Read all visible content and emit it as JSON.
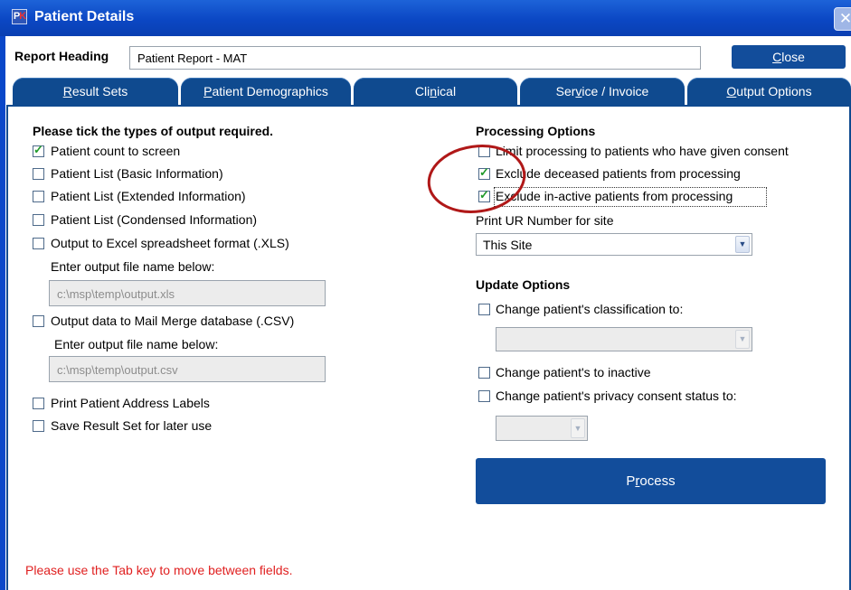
{
  "window": {
    "title": "Patient Details",
    "app_icon": "pk-app-icon",
    "close_glyph": "✕"
  },
  "header": {
    "report_heading_label": "Report Heading",
    "report_heading_value": "Patient Report - MAT",
    "close_button_rest": "lose",
    "close_button_mnemonic": "C"
  },
  "tabs": [
    {
      "pre": "",
      "mnemonic": "R",
      "post": "esult Sets",
      "active": false
    },
    {
      "pre": "",
      "mnemonic": "P",
      "post": "atient Demographics",
      "active": false
    },
    {
      "pre": "Cli",
      "mnemonic": "n",
      "post": "ical",
      "active": false
    },
    {
      "pre": "Ser",
      "mnemonic": "v",
      "post": "ice / Invoice",
      "active": false
    },
    {
      "pre": "",
      "mnemonic": "O",
      "post": "utput Options",
      "active": true
    }
  ],
  "output": {
    "heading": "Please tick the types of output required.",
    "items": [
      {
        "label": "Patient count to screen",
        "checked": true
      },
      {
        "label": "Patient List (Basic Information)",
        "checked": false
      },
      {
        "label": "Patient List (Extended Information)",
        "checked": false
      },
      {
        "label": "Patient List (Condensed Information)",
        "checked": false
      },
      {
        "label": "Output to Excel spreadsheet format (.XLS)",
        "checked": false
      }
    ],
    "xls_prompt": "Enter output file name below:",
    "xls_path": "c:\\msp\\temp\\output.xls",
    "csv_item": {
      "label": "Output data to Mail Merge database (.CSV)",
      "checked": false
    },
    "csv_prompt": "Enter output file name below:",
    "csv_path": "c:\\msp\\temp\\output.csv",
    "labels_item": {
      "label": "Print Patient Address Labels",
      "checked": false
    },
    "save_item": {
      "label": "Save Result Set for later use",
      "checked": false
    }
  },
  "processing": {
    "heading": "Processing Options",
    "items": [
      {
        "label": "Limit processing to patients who have given consent",
        "checked": false
      },
      {
        "label": "Exclude deceased patients from processing",
        "checked": true
      },
      {
        "label": "Exclude in-active patients from processing",
        "checked": true
      }
    ],
    "ur_label": "Print UR Number for site",
    "ur_value": "This Site"
  },
  "update": {
    "heading": "Update Options",
    "classification_label": "Change patient's classification to:",
    "classification_checked": false,
    "classification_value": "",
    "inactive_label": "Change patient's to inactive",
    "inactive_checked": false,
    "privacy_label": "Change patient's privacy consent status to:",
    "privacy_checked": false,
    "privacy_value": ""
  },
  "process_button": {
    "pre": "P",
    "mnemonic": "r",
    "post": "ocess"
  },
  "footer_hint": "Please use the Tab key to move between fields.",
  "colors": {
    "title_bar": "#0b47c4",
    "accent_navy": "#124d9b",
    "hint_red": "#e02020",
    "annotation_circle": "#b01818",
    "check_green": "#209a2a"
  }
}
